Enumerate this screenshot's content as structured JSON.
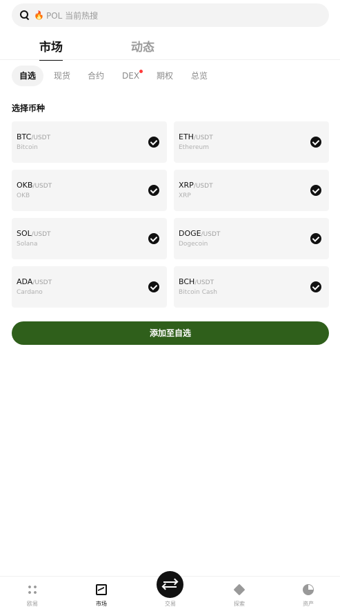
{
  "search": {
    "hot_icon": "fire-icon",
    "placeholder": "POL 当前热搜"
  },
  "main_tabs": [
    {
      "label": "市场",
      "active": true
    },
    {
      "label": "动态",
      "active": false
    }
  ],
  "sub_tabs": [
    {
      "label": "自选",
      "active": true
    },
    {
      "label": "现货"
    },
    {
      "label": "合约"
    },
    {
      "label": "DEX",
      "badge": true
    },
    {
      "label": "期权"
    },
    {
      "label": "总览"
    }
  ],
  "section_title": "选择币种",
  "coins": [
    {
      "symbol": "BTC",
      "quote": "/USDT",
      "name": "Bitcoin",
      "selected": true
    },
    {
      "symbol": "ETH",
      "quote": "/USDT",
      "name": "Ethereum",
      "selected": true
    },
    {
      "symbol": "OKB",
      "quote": "/USDT",
      "name": "OKB",
      "selected": true
    },
    {
      "symbol": "XRP",
      "quote": "/USDT",
      "name": "XRP",
      "selected": true
    },
    {
      "symbol": "SOL",
      "quote": "/USDT",
      "name": "Solana",
      "selected": true
    },
    {
      "symbol": "DOGE",
      "quote": "/USDT",
      "name": "Dogecoin",
      "selected": true
    },
    {
      "symbol": "ADA",
      "quote": "/USDT",
      "name": "Cardano",
      "selected": true
    },
    {
      "symbol": "BCH",
      "quote": "/USDT",
      "name": "Bitcoin Cash",
      "selected": true
    }
  ],
  "add_button": "添加至自选",
  "bottom_nav": [
    {
      "label": "欧易",
      "icon": "overview-icon"
    },
    {
      "label": "市场",
      "icon": "market-chart-icon",
      "active": true
    },
    {
      "label": "交易",
      "icon": "trade-swap-icon"
    },
    {
      "label": "探索",
      "icon": "explore-icon"
    },
    {
      "label": "资产",
      "icon": "assets-pie-icon"
    }
  ],
  "colors": {
    "accent": "#2f5f1b",
    "badge": "#ff3b3b",
    "card_bg": "#f5f5f5"
  }
}
